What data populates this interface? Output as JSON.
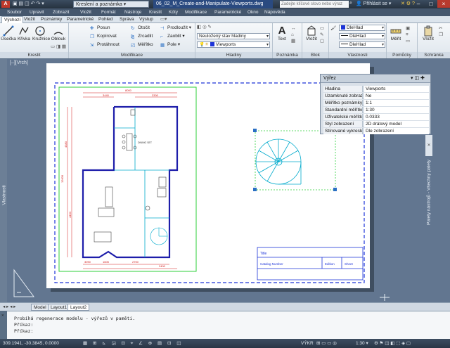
{
  "window": {
    "workspace": "Kreslení a poznámka",
    "doc_title": "06_02_M_Create-and-Manipulate-Viewports.dwg",
    "search_placeholder": "Zadejte klíčové slovo nebo výraz",
    "signin": "Přihlásit se"
  },
  "menu": [
    "Soubor",
    "Upravit",
    "Zobrazit",
    "Vložit",
    "Formát",
    "Nástroje",
    "Kreslit",
    "Kóty",
    "Modifikace",
    "Parametrické",
    "Okno",
    "Nápověda"
  ],
  "ribbon_tabs": [
    "Výchozí",
    "Vložit",
    "Poznámky",
    "Parametrické",
    "Pohled",
    "Správa",
    "Výstup"
  ],
  "ribbon": {
    "draw": {
      "tools": [
        "Úsečka",
        "Křivka",
        "Kružnice",
        "Oblouk"
      ],
      "label": "Kreslit"
    },
    "modify": {
      "col1": [
        "Posun",
        "Kopírovat",
        "Protáhnout"
      ],
      "col2": [
        "Otočit",
        "Zrcadlit",
        "Měřítko"
      ],
      "col3": [
        "Prodloužit",
        "Zaoblit",
        "Pole"
      ],
      "label": "Modifikace"
    },
    "layers": {
      "combo1": "Neuložený stav hladiny",
      "combo2": "Viewports",
      "label": "Hladiny"
    },
    "annotation": {
      "tool": "Text",
      "label": "Poznámka"
    },
    "block": {
      "tool": "Vložit",
      "label": "Blok"
    },
    "properties": {
      "combos": [
        "DleHlad",
        "DleHlad",
        "DleHlad"
      ],
      "label": "Vlastnosti"
    },
    "utilities": {
      "tool": "Měřit",
      "label": "Pomůcky"
    },
    "clipboard": {
      "tool": "Vložit",
      "label": "Schránka"
    }
  },
  "left_palette": "Vlastnosti",
  "properties": {
    "selection": "Výřez",
    "rows": [
      {
        "key": "Hladina",
        "value": "Viewports"
      },
      {
        "key": "Uzamknuté zobrazení",
        "value": "Ne"
      },
      {
        "key": "Měřítko poznámky",
        "value": "1:1"
      },
      {
        "key": "Standardní měřítko",
        "value": "1:30"
      },
      {
        "key": "Uživatelské měřítko",
        "value": "0.0333"
      },
      {
        "key": "Styl zobrazení",
        "value": "2D drátový model"
      },
      {
        "key": "Stínované vykreslení",
        "value": "Dle zobrazení"
      }
    ]
  },
  "right_palette": "Palety nástrojů - Všechny palety",
  "drawing": {
    "dims_top": [
      "3440",
      "8000",
      "3300"
    ],
    "dims_left": [
      "4380",
      "12600",
      "4450"
    ],
    "dims_bottom": [
      "3090",
      "1605",
      "2700",
      "2400"
    ],
    "room_label": "DINING SET"
  },
  "title_block": {
    "title": "Title",
    "catalog": "Catalog Number",
    "edition": "Edition",
    "sheet": "Sheet"
  },
  "layout_tabs": [
    "Model",
    "Layout1",
    "Layout2"
  ],
  "command": {
    "lines": [
      "Probíhá regenerace modelu - výřezů v paměti.",
      "Příkaz:",
      "Příkaz:"
    ]
  },
  "status": {
    "coords": "309.1941, -30.3845, 0.0000",
    "mode": "VÝKR",
    "scale": "1:30"
  },
  "colors": {
    "accent": "#2a4a80",
    "viewport": "#0000cc",
    "stair": "#00aacc"
  }
}
